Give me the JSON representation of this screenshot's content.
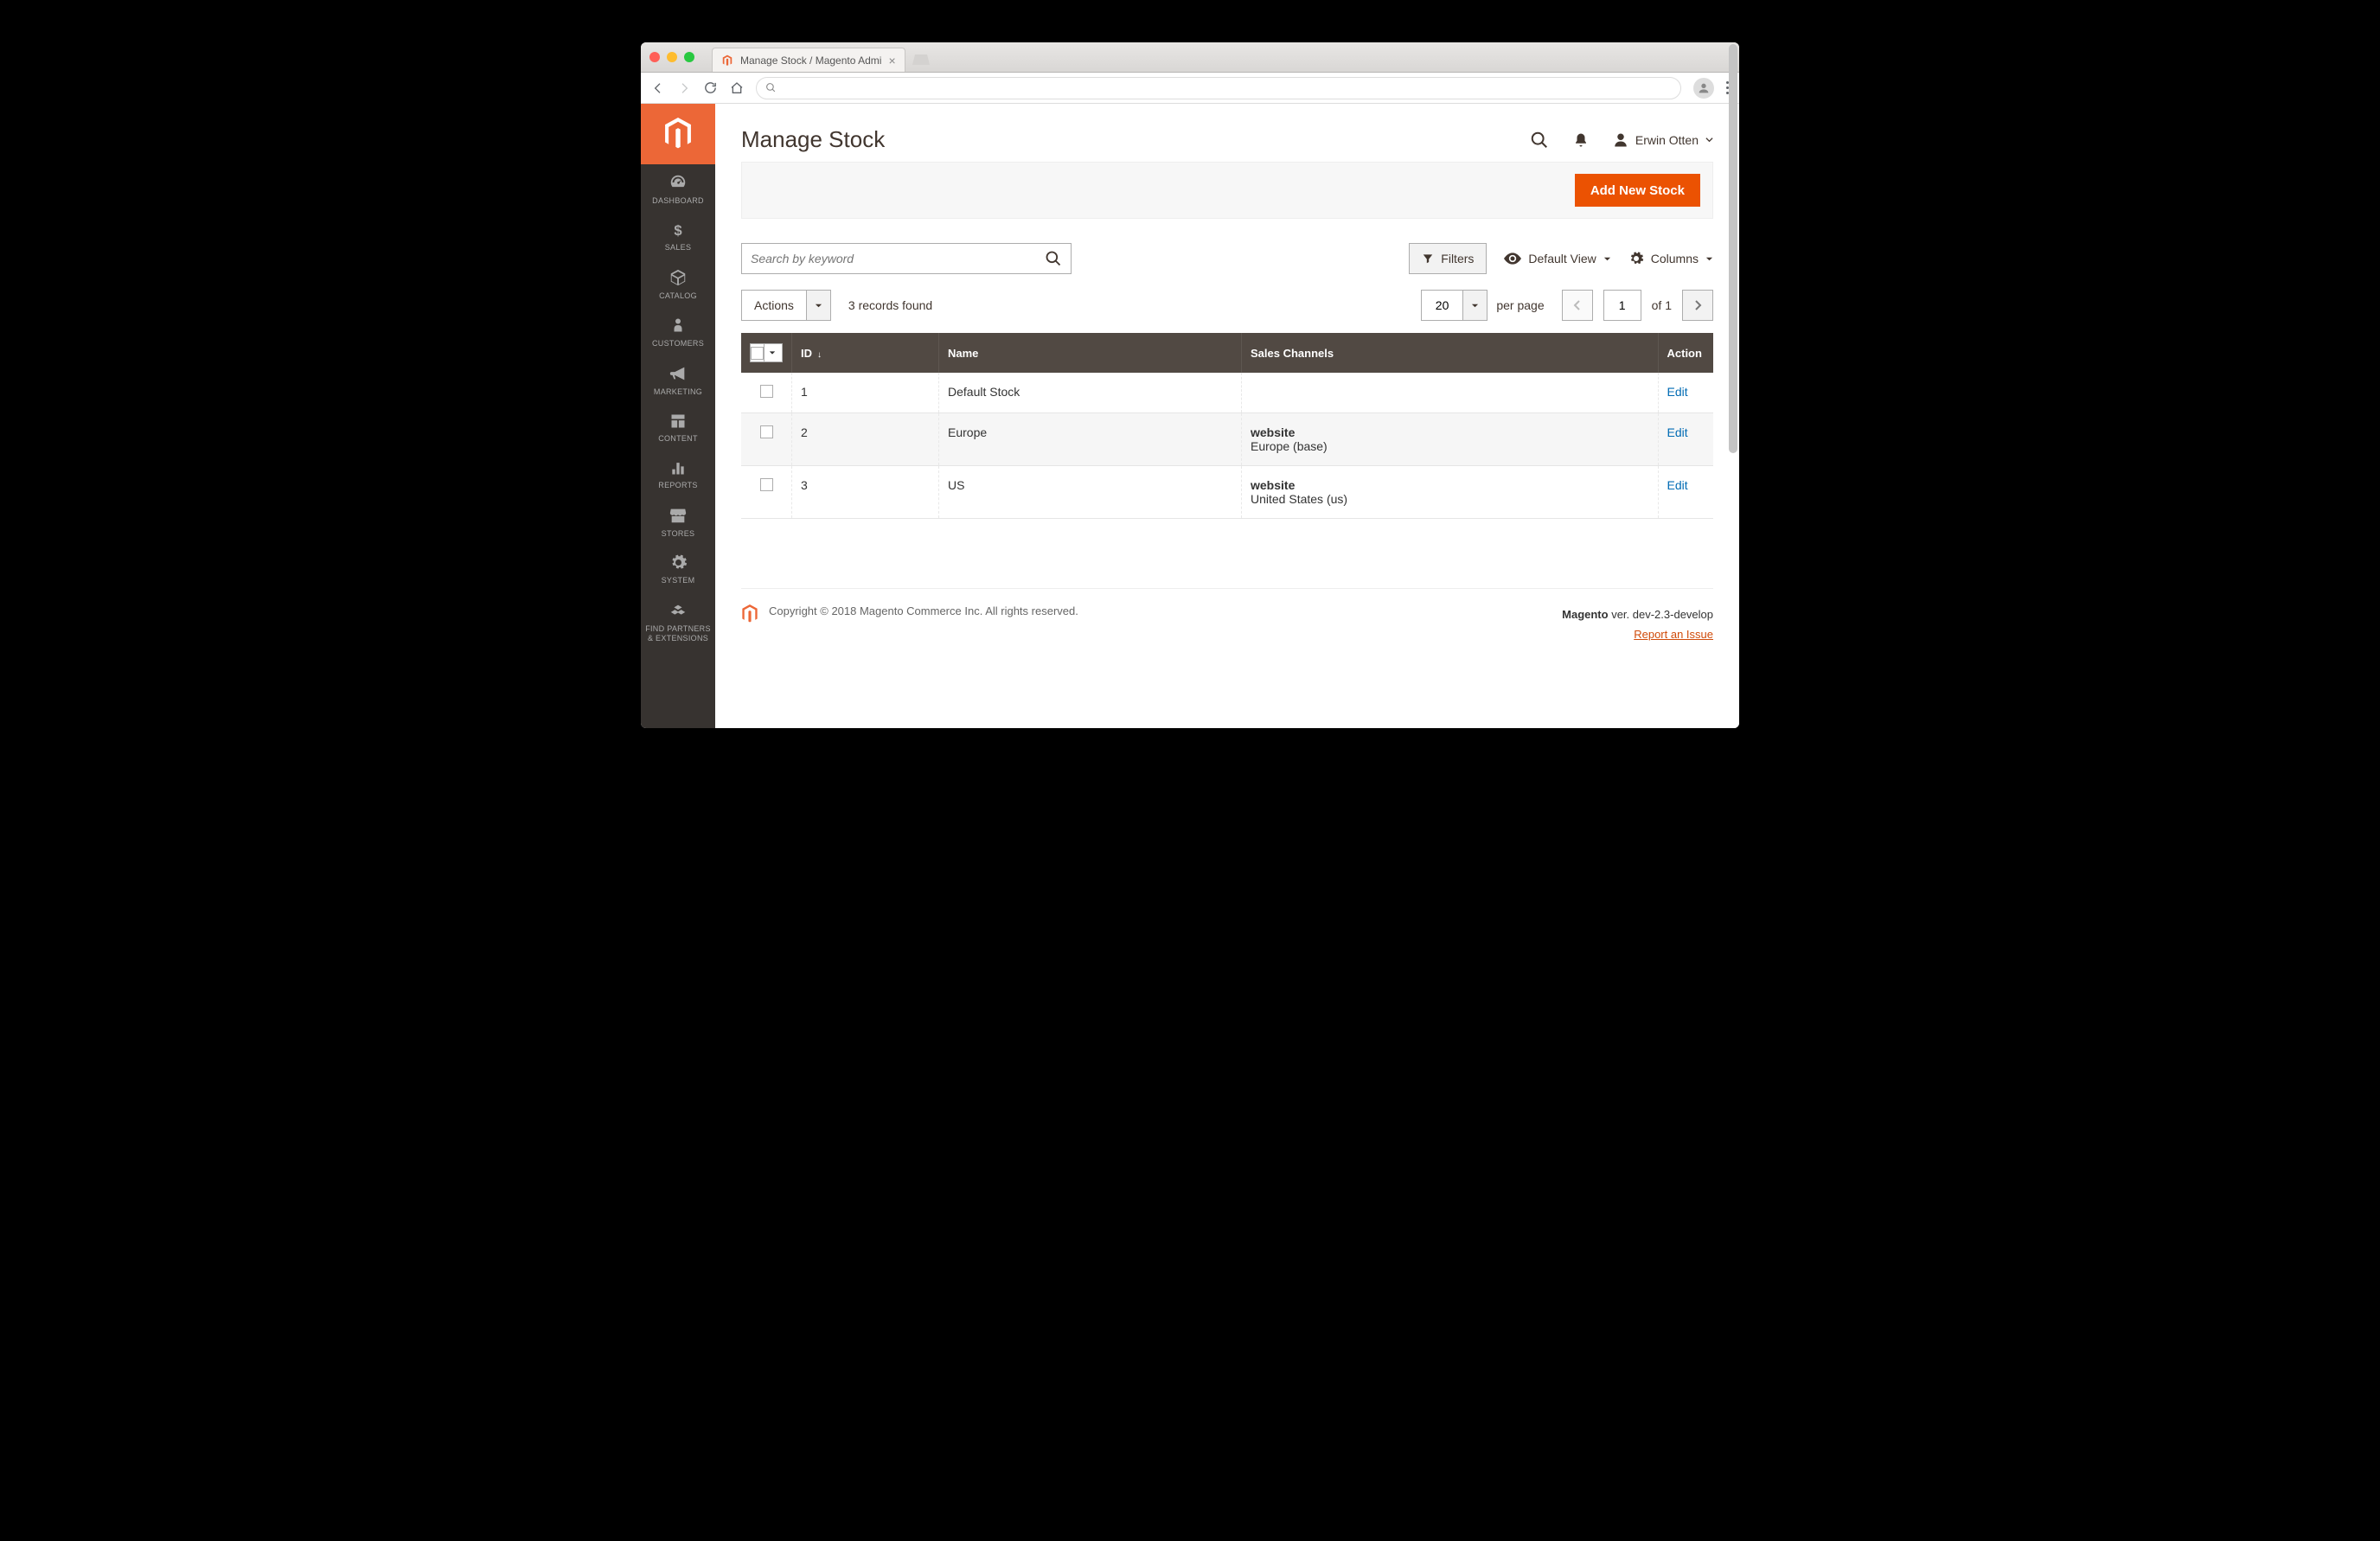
{
  "browser": {
    "tab_title": "Manage Stock / Magento Admi",
    "url_placeholder": ""
  },
  "sidebar": {
    "items": [
      {
        "label": "DASHBOARD",
        "icon": "dashboard"
      },
      {
        "label": "SALES",
        "icon": "dollar"
      },
      {
        "label": "CATALOG",
        "icon": "box"
      },
      {
        "label": "CUSTOMERS",
        "icon": "person"
      },
      {
        "label": "MARKETING",
        "icon": "megaphone"
      },
      {
        "label": "CONTENT",
        "icon": "layout"
      },
      {
        "label": "REPORTS",
        "icon": "bars"
      },
      {
        "label": "STORES",
        "icon": "storefront"
      },
      {
        "label": "SYSTEM",
        "icon": "gear"
      },
      {
        "label": "FIND PARTNERS & EXTENSIONS",
        "icon": "blocks"
      }
    ]
  },
  "header": {
    "title": "Manage Stock",
    "user_name": "Erwin Otten"
  },
  "actionbar": {
    "primary_button": "Add New Stock"
  },
  "toolbar": {
    "search_placeholder": "Search by keyword",
    "filters_label": "Filters",
    "default_view_label": "Default View",
    "columns_label": "Columns",
    "actions_label": "Actions",
    "records_found": "3 records found",
    "per_page_value": "20",
    "per_page_label": "per page",
    "page_current": "1",
    "page_of": "of 1"
  },
  "table": {
    "columns": {
      "id": "ID",
      "name": "Name",
      "channels": "Sales Channels",
      "action": "Action"
    },
    "rows": [
      {
        "id": "1",
        "name": "Default Stock",
        "channel_type": "",
        "channel_value": "",
        "action": "Edit"
      },
      {
        "id": "2",
        "name": "Europe",
        "channel_type": "website",
        "channel_value": "Europe (base)",
        "action": "Edit"
      },
      {
        "id": "3",
        "name": "US",
        "channel_type": "website",
        "channel_value": "United States (us)",
        "action": "Edit"
      }
    ]
  },
  "footer": {
    "copyright": "Copyright © 2018 Magento Commerce Inc. All rights reserved.",
    "version_prefix": "Magento",
    "version": " ver. dev-2.3-develop",
    "report_issue": "Report an Issue"
  }
}
